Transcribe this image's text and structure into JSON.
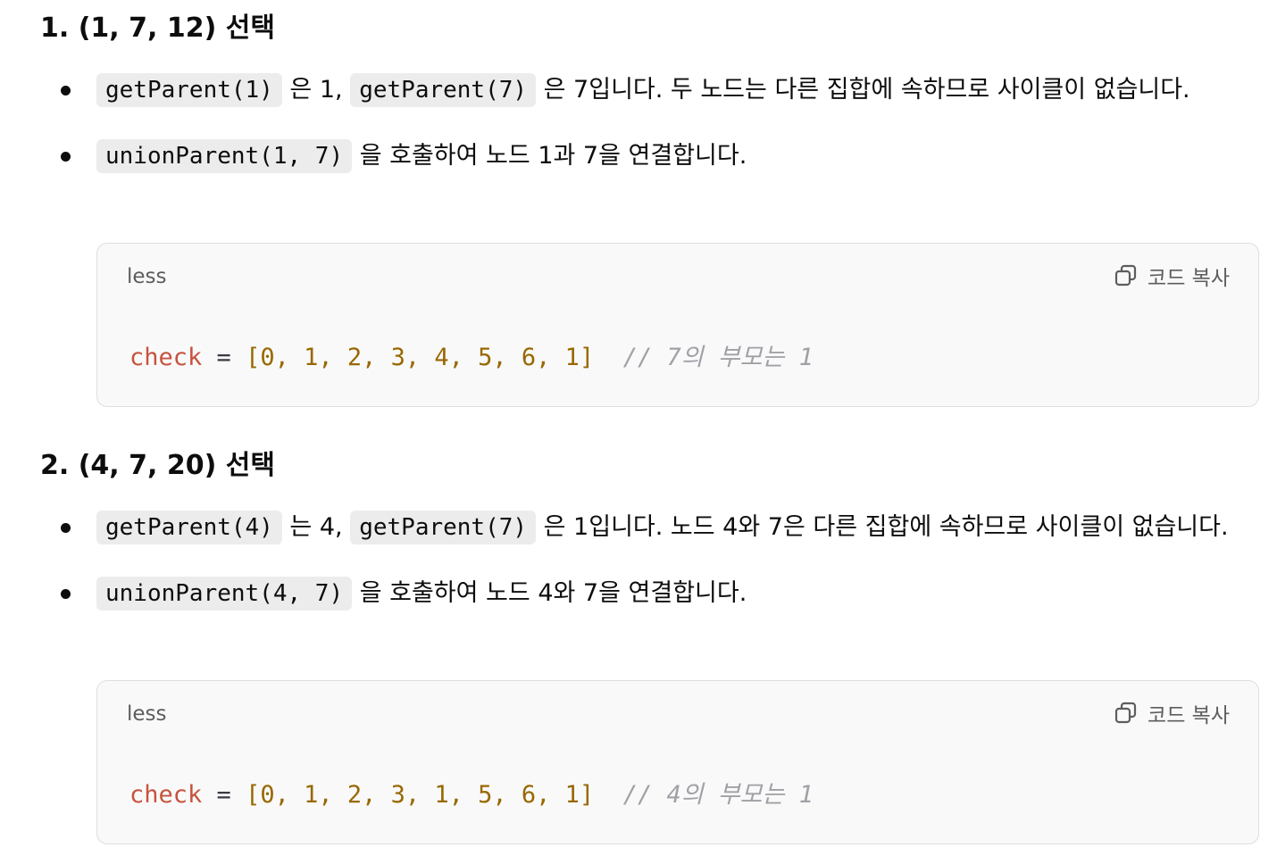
{
  "sections": [
    {
      "heading": "1. (1, 7, 12) 선택",
      "bullets": [
        {
          "code1": "getParent(1)",
          "text1": " 은 1, ",
          "code2": "getParent(7)",
          "text2": " 은 7입니다. 두 노드는 다른 집합에 속하므로 사이클이 없습니다."
        },
        {
          "code1": "unionParent(1, 7)",
          "text1": " 을 호출하여 노드 1과 7을 연결합니다."
        }
      ],
      "code_block": {
        "language": "less",
        "copy_label": "코드 복사",
        "var": "check",
        "op": " = ",
        "array": "[0, 1, 2, 3, 4, 5, 6, 1]",
        "comment": "  // 7의 부모는 1"
      }
    },
    {
      "heading": "2. (4, 7, 20) 선택",
      "bullets": [
        {
          "code1": "getParent(4)",
          "text1": " 는 4, ",
          "code2": "getParent(7)",
          "text2": " 은 1입니다. 노드 4와 7은 다른 집합에 속하므로 사이클이 없습니다."
        },
        {
          "code1": "unionParent(4, 7)",
          "text1": " 을 호출하여 노드 4와 7을 연결합니다."
        }
      ],
      "code_block": {
        "language": "less",
        "copy_label": "코드 복사",
        "var": "check",
        "op": " = ",
        "array": "[0, 1, 2, 3, 1, 5, 6, 1]",
        "comment": "  // 4의 부모는 1"
      }
    }
  ],
  "icons": {
    "copy": "copy-icon"
  },
  "colors": {
    "code_bg": "#f9f9f9",
    "inline_code_bg": "#ececec",
    "token_variable": "#c6533e",
    "token_array": "#986801",
    "token_comment": "#a0a1a7"
  }
}
